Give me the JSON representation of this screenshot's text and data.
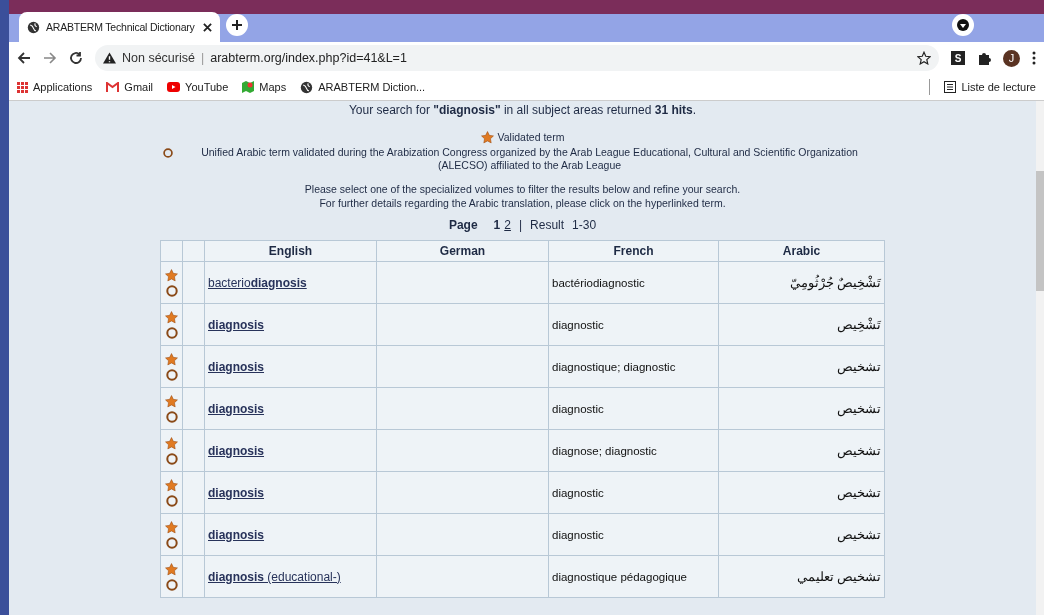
{
  "browser": {
    "tab": {
      "title": "ARABTERM Technical Dictionary",
      "selected": true
    },
    "address": {
      "security": "Non sécurisé",
      "separator": "|",
      "url": "arabterm.org/index.php?id=41&L=1"
    },
    "profile": {
      "initial": "J"
    },
    "extension": {
      "label": "S"
    },
    "bookmarks": [
      "Applications",
      "Gmail",
      "YouTube",
      "Maps",
      "ARABTERM Diction..."
    ],
    "reading_list": "Liste de lecture"
  },
  "summary": "Your search for **\"diagnosis\"** in all subject areas returned **31 hits**.",
  "legend": [
    {
      "kind": "star",
      "text": "Validated term"
    },
    {
      "kind": "circle",
      "text": "Unified Arabic term validated during the Arabization Congress organized by the Arab League Educational, Cultural and Scientific Organization (ALECSO) affiliated to the Arab League"
    }
  ],
  "instructions": [
    "Please select one of the specialized volumes to filter the results below and refine your search.",
    "For further details regarding the Arabic translation, please click on the hyperlinked term."
  ],
  "pagination": {
    "label": "Page",
    "pages": [
      {
        "label": "1",
        "selected": true
      },
      {
        "label": "2",
        "selected": false
      }
    ],
    "separator": "|",
    "result_label": "Result",
    "range": "1-30"
  },
  "table": {
    "columns": [
      "English",
      "German",
      "French",
      "Arabic"
    ],
    "rows": [
      {
        "validated": true,
        "unified": true,
        "english": "bacterio**diagnosis**",
        "french": "bactériodiagnostic",
        "arabic": "تَشْخِيصٌ جُرْثُومِيّ"
      },
      {
        "validated": true,
        "unified": true,
        "english": "**diagnosis**",
        "french": "diagnostic",
        "arabic": "تَشْخِيص"
      },
      {
        "validated": true,
        "unified": true,
        "english": "**diagnosis**",
        "french": "diagnostique; diagnostic",
        "arabic": "تشخيص"
      },
      {
        "validated": true,
        "unified": true,
        "english": "**diagnosis**",
        "french": "diagnostic",
        "arabic": "تشخيص"
      },
      {
        "validated": true,
        "unified": true,
        "english": "**diagnosis**",
        "french": "diagnose; diagnostic",
        "arabic": "تشخيص"
      },
      {
        "validated": true,
        "unified": true,
        "english": "**diagnosis**",
        "french": "diagnostic",
        "arabic": "تشخيص"
      },
      {
        "validated": true,
        "unified": true,
        "english": "**diagnosis**",
        "french": "diagnostic",
        "arabic": "تشخيص"
      },
      {
        "validated": true,
        "unified": true,
        "english": "**diagnosis** (educational-)",
        "french": "diagnostique pédagogique",
        "arabic": "تشخيص تعليمي"
      }
    ]
  }
}
